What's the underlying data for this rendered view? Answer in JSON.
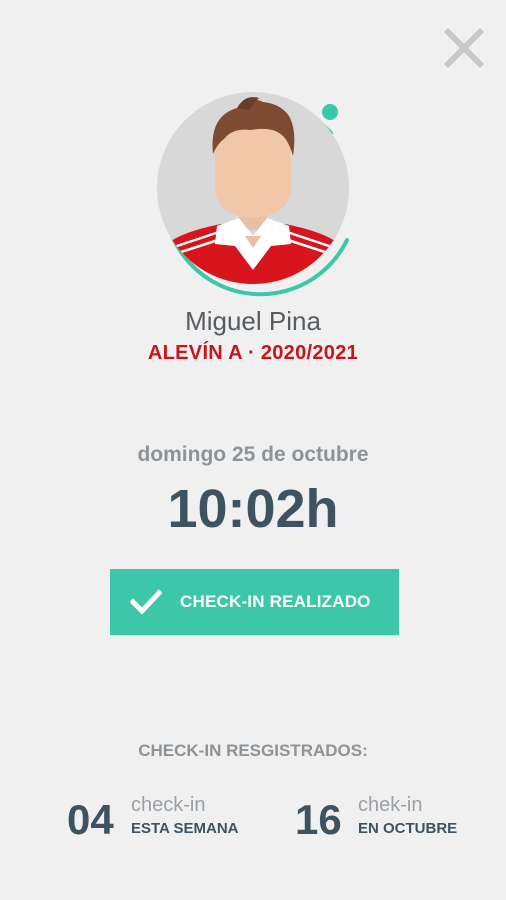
{
  "header": {
    "close_icon": "close-icon"
  },
  "player": {
    "avatar_icon": "player-avatar",
    "name": "Miguel Pina",
    "team": "ALEVÍN A · 2020/2021"
  },
  "checkin": {
    "date": "domingo 25 de octubre",
    "time": "10:02h",
    "button_label": "CHECK-IN REALIZADO",
    "button_icon": "check-icon"
  },
  "stats": {
    "title": "CHECK-IN RESGISTRADOS:",
    "week": {
      "count": "04",
      "unit": "check-in",
      "period": "ESTA SEMANA"
    },
    "month": {
      "count": "16",
      "unit": "chek-in",
      "period": "EN OCTUBRE"
    }
  },
  "colors": {
    "background": "#f0f0f0",
    "accent": "#3cc7a9",
    "team_red": "#c8151b",
    "dark_text": "#3d5360",
    "muted_text": "#8d9499"
  }
}
